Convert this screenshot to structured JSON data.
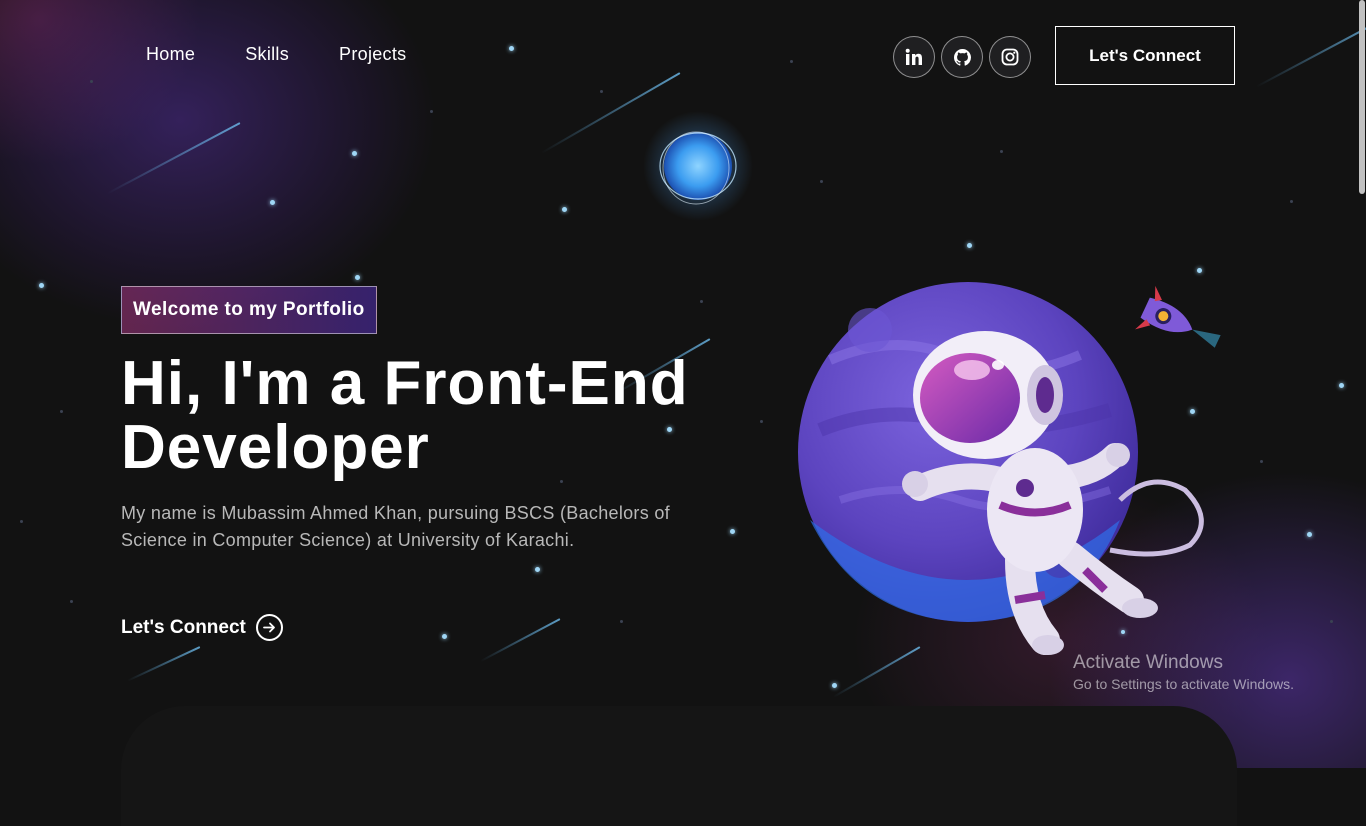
{
  "nav": {
    "links": [
      "Home",
      "Skills",
      "Projects"
    ],
    "socials": [
      "linkedin-icon",
      "github-icon",
      "instagram-icon"
    ],
    "connect_label": "Let's Connect"
  },
  "hero": {
    "tagline": "Welcome to my Portfolio",
    "headline_line1": "Hi, I'm a Front-End",
    "headline_line2": "Developer",
    "description": "My name is Mubassim Ahmed Khan, pursuing BSCS (Bachelors of Science in Computer Science) at University of Karachi.",
    "cta_label": "Let's Connect"
  },
  "watermark": {
    "title": "Activate Windows",
    "subtitle": "Go to Settings to activate Windows."
  },
  "colors": {
    "background": "#121212",
    "tagline_gradient_start": "#aa367c",
    "tagline_gradient_end": "#4a2fbd",
    "planet": "#6a4fc8",
    "star": "#9fd6f5"
  }
}
